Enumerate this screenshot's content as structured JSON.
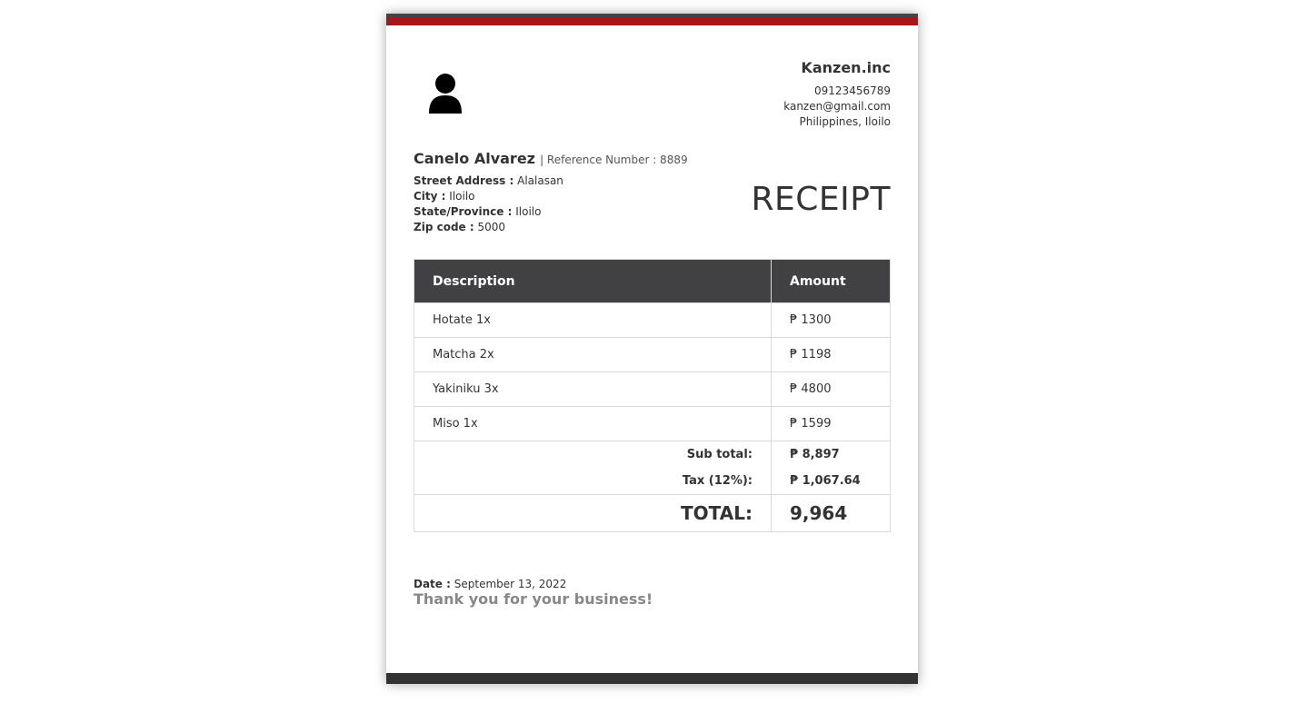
{
  "company": {
    "name": "Kanzen.inc",
    "phone": "09123456789",
    "email": "kanzen@gmail.com",
    "location": "Philippines, Iloilo"
  },
  "customer": {
    "name": "Canelo Alvarez",
    "reference": "| Reference Number : 8889",
    "street_label": "Street Address :",
    "street": "Alalasan",
    "city_label": "City :",
    "city": "Iloilo",
    "state_label": "State/Province :",
    "state": "Iloilo",
    "zip_label": "Zip code :",
    "zip": "5000"
  },
  "document_title": "RECEIPT",
  "table": {
    "headers": [
      "Description",
      "Amount"
    ],
    "rows": [
      {
        "description": "Hotate 1x",
        "amount": "₱ 1300"
      },
      {
        "description": "Matcha 2x",
        "amount": "₱ 1198"
      },
      {
        "description": "Yakiniku 3x",
        "amount": "₱ 4800"
      },
      {
        "description": "Miso 1x",
        "amount": "₱ 1599"
      }
    ],
    "subtotal_label": "Sub total:",
    "subtotal": "₱ 8,897",
    "tax_label": "Tax (12%):",
    "tax": "₱ 1,067.64",
    "total_label": "TOTAL:",
    "total": "9,964"
  },
  "footer": {
    "date_label": "Date :",
    "date": "September 13, 2022",
    "thanks": "Thank you for your business!"
  },
  "colors": {
    "accent": "#a6171c",
    "header_bg": "#414042",
    "footer_bar": "#333333"
  },
  "icons": {
    "avatar": "user-silhouette-icon"
  }
}
